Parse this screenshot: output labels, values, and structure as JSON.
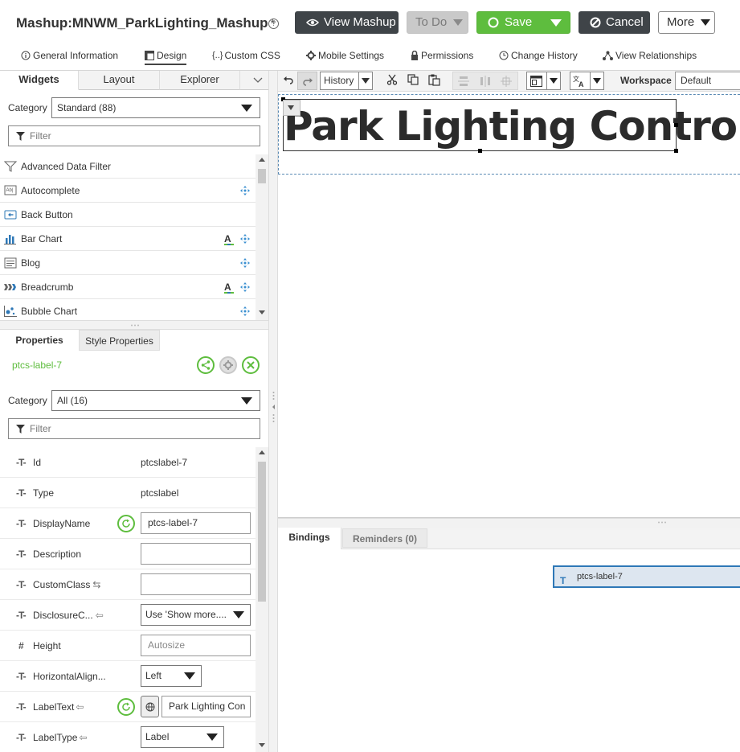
{
  "header": {
    "title": "Mashup:MNWM_ParkLighting_Mashup",
    "unsaved_marker": "*",
    "help_icon": "question-icon",
    "buttons": {
      "view_mashup": "View Mashup",
      "todo": "To Do",
      "save": "Save",
      "cancel": "Cancel",
      "more": "More"
    },
    "tabs": [
      {
        "label": "General Information",
        "icon": "info-icon"
      },
      {
        "label": "Design",
        "icon": "layout-icon"
      },
      {
        "label": "Custom CSS",
        "icon": "braces-icon"
      },
      {
        "label": "Mobile Settings",
        "icon": "gear-icon"
      },
      {
        "label": "Permissions",
        "icon": "lock-icon"
      },
      {
        "label": "Change History",
        "icon": "clock-icon"
      },
      {
        "label": "View Relationships",
        "icon": "graph-icon"
      }
    ],
    "active_tab": "Design"
  },
  "widgets_panel": {
    "tabs": [
      "Widgets",
      "Layout",
      "Explorer"
    ],
    "active_tab": "Widgets",
    "category_label": "Category",
    "category_value": "Standard (88)",
    "filter_placeholder": "Filter",
    "items": [
      {
        "label": "Advanced Data Filter",
        "icon": "filter-funnel-icon",
        "autocomplete_icon": false,
        "move_icon": false
      },
      {
        "label": "Autocomplete",
        "icon": "autocomplete-icon",
        "autocomplete_icon": false,
        "move_icon": true
      },
      {
        "label": "Back Button",
        "icon": "back-button-icon",
        "autocomplete_icon": false,
        "move_icon": false
      },
      {
        "label": "Bar Chart",
        "icon": "bar-chart-icon",
        "autocomplete_icon": true,
        "move_icon": true
      },
      {
        "label": "Blog",
        "icon": "blog-icon",
        "autocomplete_icon": false,
        "move_icon": true
      },
      {
        "label": "Breadcrumb",
        "icon": "breadcrumb-icon",
        "autocomplete_icon": true,
        "move_icon": true
      },
      {
        "label": "Bubble Chart",
        "icon": "bubble-chart-icon",
        "autocomplete_icon": false,
        "move_icon": true
      }
    ]
  },
  "properties_panel": {
    "tabs": [
      "Properties",
      "Style Properties"
    ],
    "active_tab": "Properties",
    "selected_widget": "ptcs-label-7",
    "category_label": "Category",
    "category_value": "All (16)",
    "filter_placeholder": "Filter",
    "rows": [
      {
        "name": "Id",
        "type_icon": "T",
        "value": "ptcslabel-7",
        "kind": "text"
      },
      {
        "name": "Type",
        "type_icon": "T",
        "value": "ptcslabel",
        "kind": "text"
      },
      {
        "name": "DisplayName",
        "type_icon": "T",
        "value": "ptcs-label-7",
        "kind": "input",
        "reset": true
      },
      {
        "name": "Description",
        "type_icon": "T",
        "value": "",
        "kind": "input"
      },
      {
        "name": "CustomClass",
        "type_icon": "T",
        "value": "",
        "kind": "input",
        "bind_icon": "bidirectional-icon"
      },
      {
        "name": "DisclosureC...",
        "type_icon": "T",
        "value": "Use 'Show more....",
        "kind": "select",
        "bind_icon": "inbound-icon"
      },
      {
        "name": "Height",
        "type_icon": "#",
        "value": "Autosize",
        "kind": "input-placeholder"
      },
      {
        "name": "HorizontalAlign...",
        "type_icon": "T",
        "value": "Left",
        "kind": "select-small"
      },
      {
        "name": "LabelText",
        "type_icon": "T",
        "value": "Park Lighting Con",
        "kind": "input-localized",
        "reset": true,
        "bind_icon": "inbound-icon"
      },
      {
        "name": "LabelType",
        "type_icon": "T",
        "value": "Label",
        "kind": "select-medium",
        "bind_icon": "inbound-icon"
      }
    ]
  },
  "toolbar": {
    "history_label": "History",
    "workspace_label": "Workspace",
    "workspace_value": "Default"
  },
  "canvas": {
    "label_text": "Park Lighting Control"
  },
  "bottom_panel": {
    "tabs": [
      "Bindings",
      "Reminders (0)"
    ],
    "active_tab": "Bindings",
    "binding_node": "ptcs-label-7"
  },
  "colors": {
    "accent_green": "#5ebd3e",
    "dark_button": "#3f4448",
    "selection_blue": "#2e78b7"
  }
}
